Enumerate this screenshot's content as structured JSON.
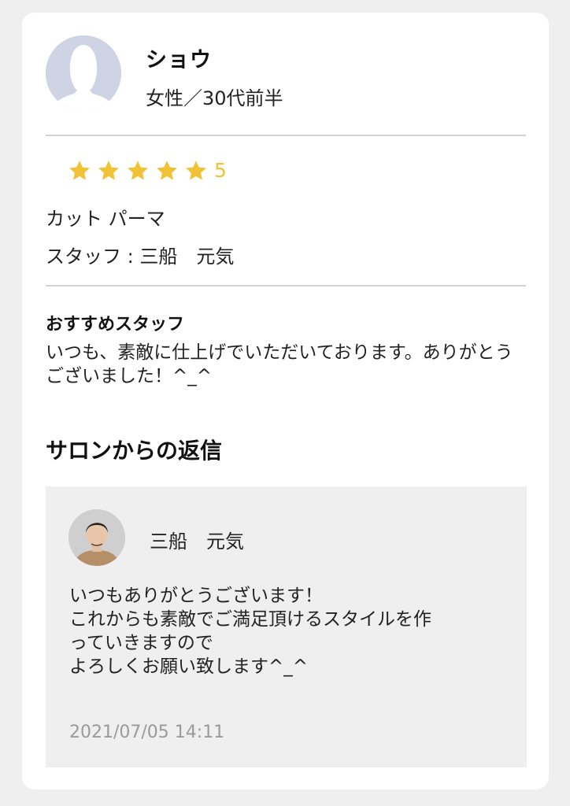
{
  "reviewer": {
    "name": "ショウ",
    "meta": "女性／30代前半"
  },
  "rating": {
    "stars": 5,
    "max": 5,
    "value_label": "5",
    "star_color": "#f2c236"
  },
  "review": {
    "menu": "カット パーマ",
    "staff": "スタッフ : 三船　元気",
    "comment_heading": "おすすめスタッフ",
    "comment_body": "いつも、素敵に仕上げでいただいております。ありがとうございました！^_^"
  },
  "reply": {
    "section_title": "サロンからの返信",
    "staff_name": "三船　元気",
    "lines": [
      "いつもありがとうございます！",
      "これからも素敵でご満足頂けるスタイルを作",
      "っていきますので",
      "よろしくお願い致します^_^"
    ],
    "date": "2021/07/05 14:11"
  }
}
